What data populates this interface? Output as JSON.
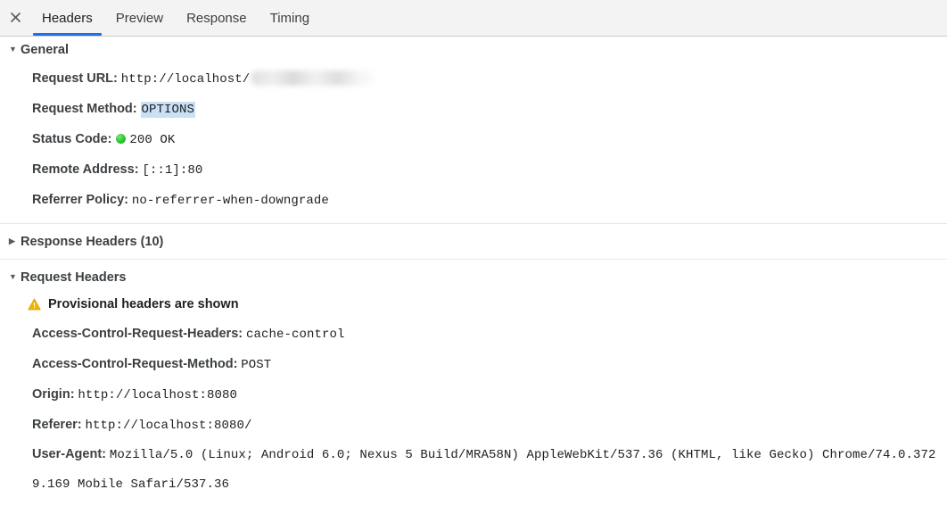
{
  "tabbar": {
    "close_icon": "close-icon",
    "tabs": [
      {
        "label": "Headers",
        "active": true
      },
      {
        "label": "Preview",
        "active": false
      },
      {
        "label": "Response",
        "active": false
      },
      {
        "label": "Timing",
        "active": false
      }
    ]
  },
  "sections": {
    "general": {
      "title": "General",
      "expanded": true,
      "triangle": "▼",
      "rows": [
        {
          "label": "Request URL:",
          "value": "http://localhost/",
          "redacted": true
        },
        {
          "label": "Request Method:",
          "value": "OPTIONS",
          "selected": true
        },
        {
          "label": "Status Code:",
          "value": "200  OK",
          "status_dot": true,
          "dot_color": "#35cc35"
        },
        {
          "label": "Remote Address:",
          "value": "[::1]:80"
        },
        {
          "label": "Referrer Policy:",
          "value": "no-referrer-when-downgrade"
        }
      ]
    },
    "response_headers": {
      "title": "Response Headers (10)",
      "expanded": false,
      "triangle": "▶"
    },
    "request_headers": {
      "title": "Request Headers",
      "expanded": true,
      "triangle": "▼",
      "warning": {
        "icon": "warning-triangle-icon",
        "text": "Provisional headers are shown",
        "color": "#f0b400"
      },
      "rows": [
        {
          "label": "Access-Control-Request-Headers:",
          "value": "cache-control"
        },
        {
          "label": "Access-Control-Request-Method:",
          "value": "POST"
        },
        {
          "label": "Origin:",
          "value": "http://localhost:8080"
        },
        {
          "label": "Referer:",
          "value": "http://localhost:8080/"
        },
        {
          "label": "User-Agent:",
          "value": "Mozilla/5.0 (Linux; Android 6.0; Nexus 5 Build/MRA58N) AppleWebKit/537.36 (KHTML, like Gecko) Chrome/74.0.3729.169 Mobile Safari/537.36"
        }
      ]
    }
  },
  "colors": {
    "accent": "#1a73e8",
    "selection": "#c9e0f5",
    "status_ok": "#35cc35",
    "warning": "#f0b400",
    "toolbar_bg": "#f3f3f3"
  }
}
